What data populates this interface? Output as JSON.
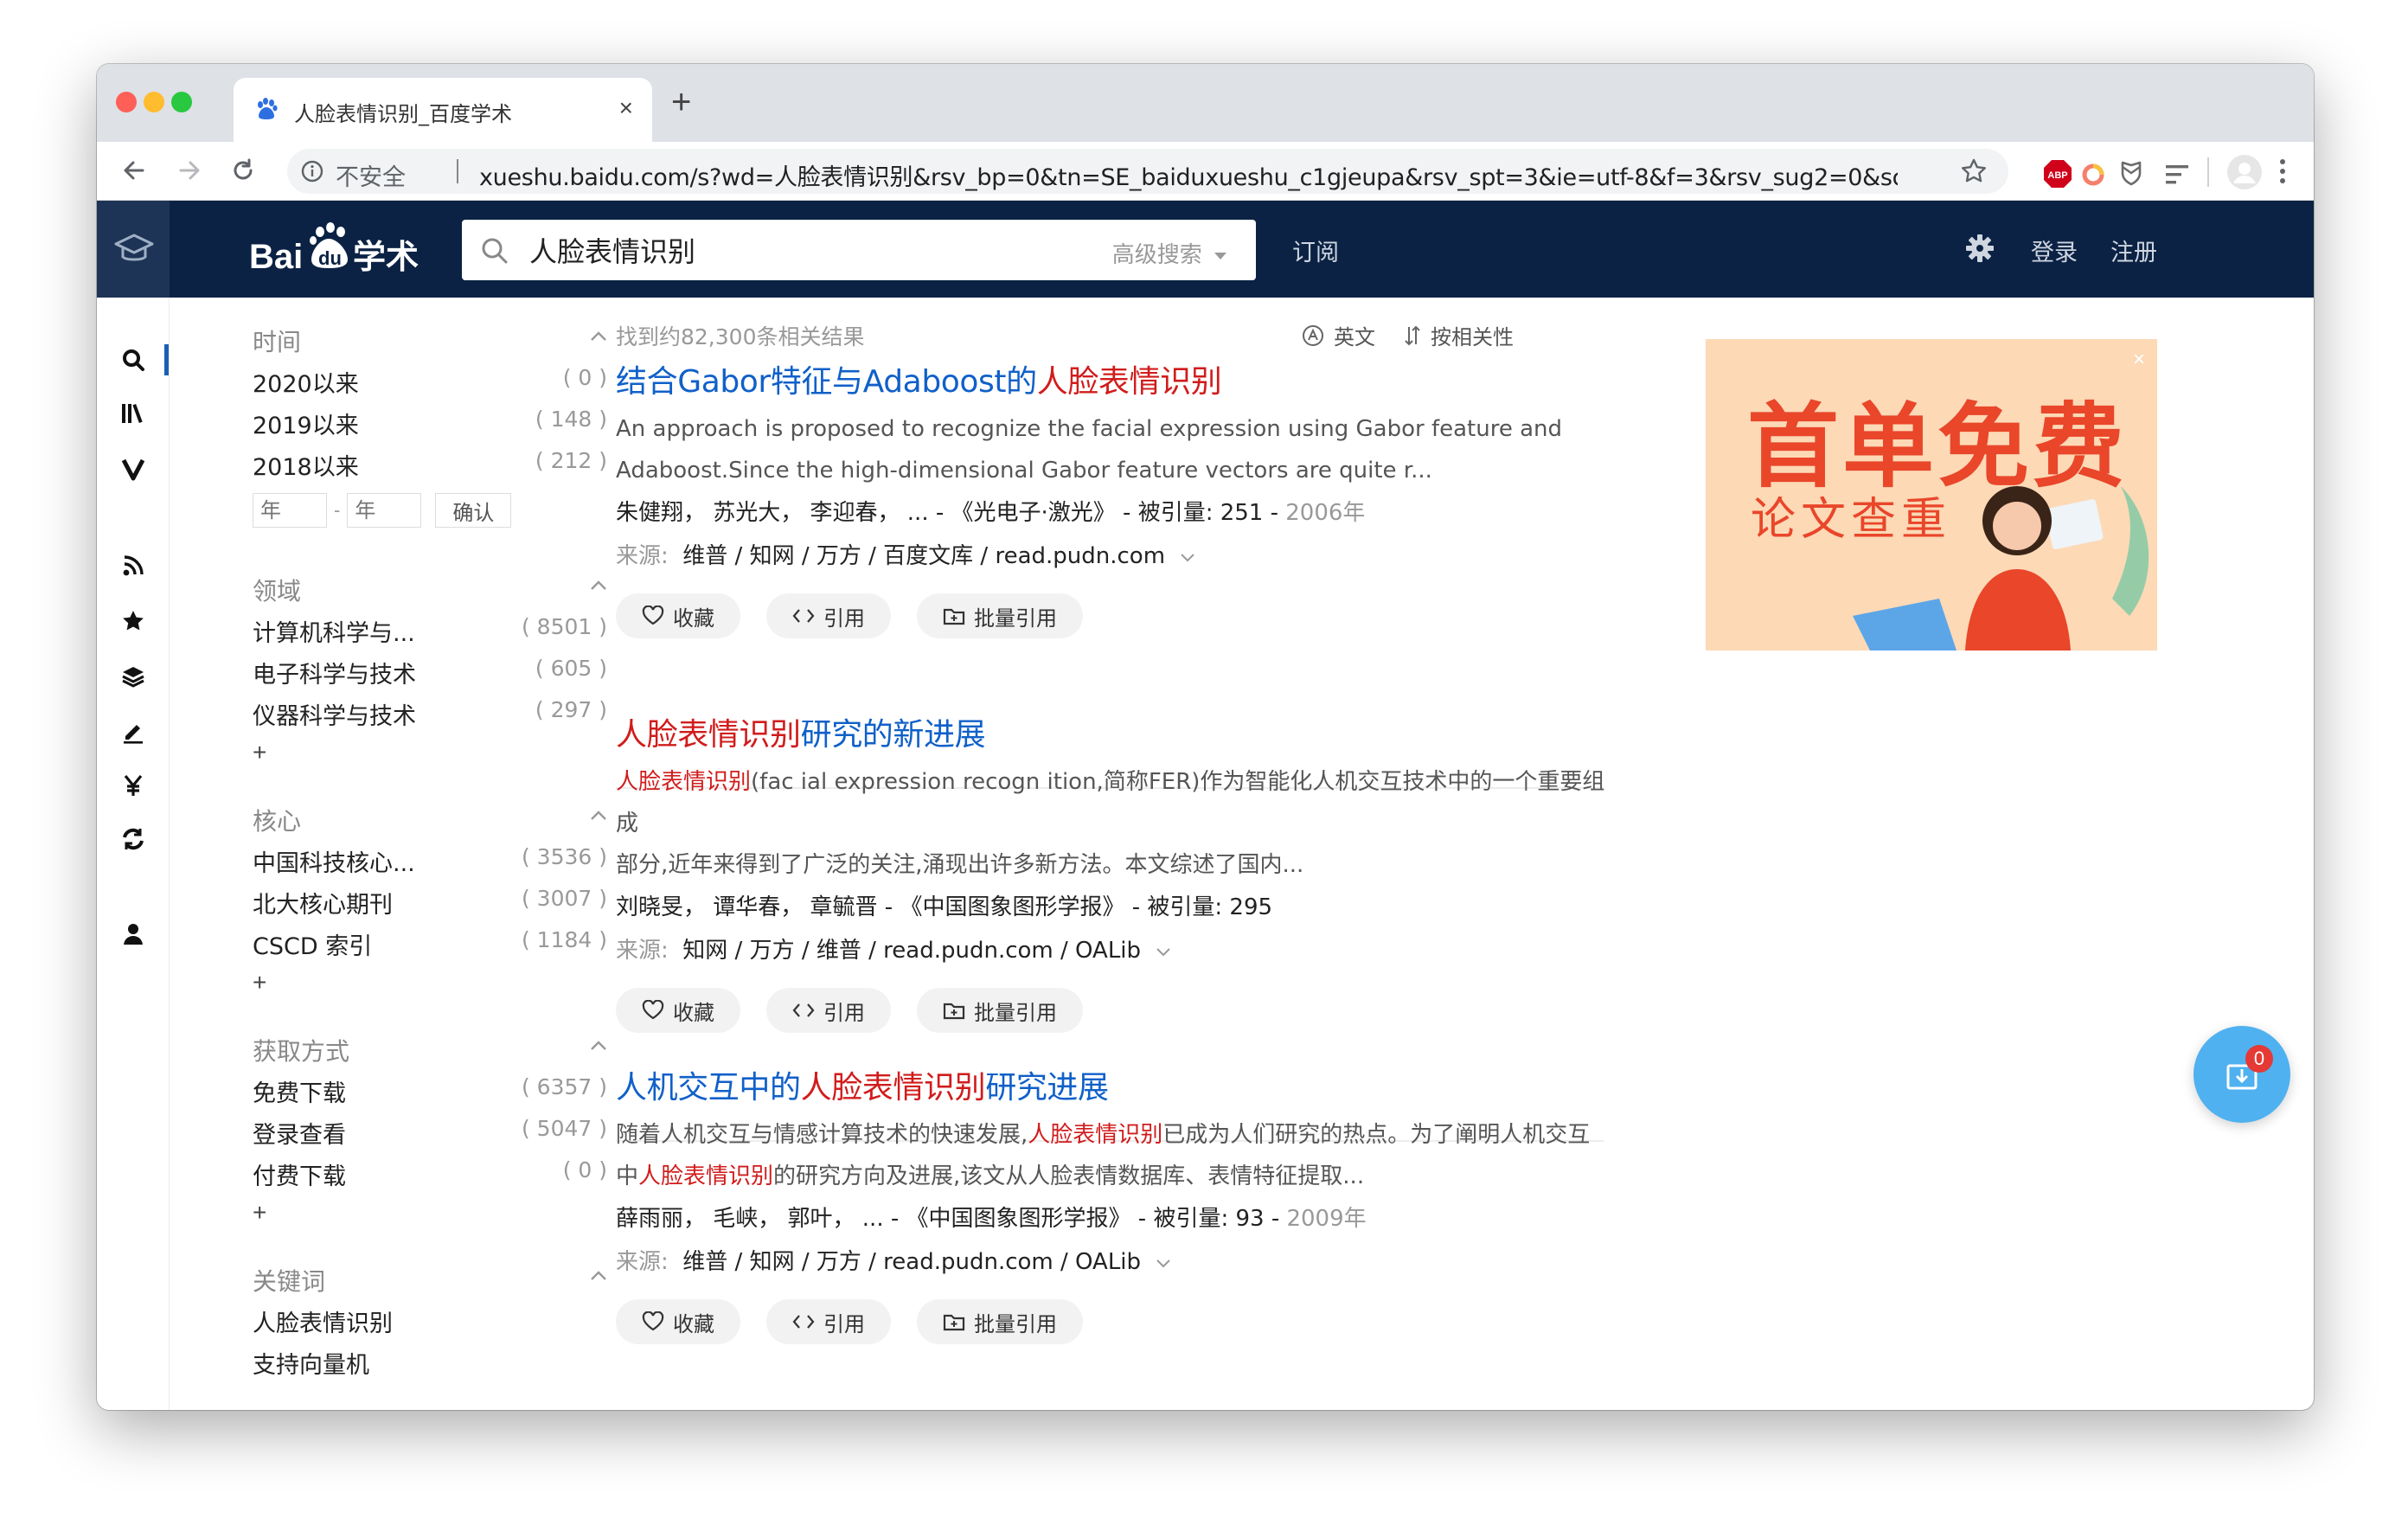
{
  "browser": {
    "tab_title": "人脸表情识别_百度学术",
    "close_glyph": "×",
    "new_tab_glyph": "+",
    "security_label": "不安全",
    "url": "xueshu.baidu.com/s?wd=人脸表情识别&rsv_bp=0&tn=SE_baiduxueshu_c1gjeupa&rsv_spt=3&ie=utf-8&f=3&rsv_sug2=0&sc_f_p...",
    "ext_abp_label": "ABP"
  },
  "header": {
    "logo_text": "Bai",
    "logo_du": "du",
    "logo_suffix": "学术",
    "search_value": "人脸表情识别",
    "advanced_search": "高级搜索",
    "subscribe": "订阅",
    "login": "登录",
    "register": "注册"
  },
  "rail_icons": [
    "search-icon",
    "library-icon",
    "v-icon",
    "rss-icon",
    "star-icon",
    "layers-icon",
    "edit-icon",
    "yen-icon",
    "refresh-icon",
    "user-icon"
  ],
  "filters": {
    "time": {
      "title": "时间",
      "rows": [
        {
          "label": "2020以来",
          "count": "( 0 )"
        },
        {
          "label": "2019以来",
          "count": "( 148 )"
        },
        {
          "label": "2018以来",
          "count": "( 212 )"
        }
      ],
      "year_placeholder": "年",
      "dash": "-",
      "confirm": "确认"
    },
    "field": {
      "title": "领域",
      "rows": [
        {
          "label": "计算机科学与...",
          "count": "( 8501 )"
        },
        {
          "label": "电子科学与技术",
          "count": "( 605 )"
        },
        {
          "label": "仪器科学与技术",
          "count": "( 297 )"
        }
      ],
      "more": "+"
    },
    "core": {
      "title": "核心",
      "rows": [
        {
          "label": "中国科技核心...",
          "count": "( 3536 )"
        },
        {
          "label": "北大核心期刊",
          "count": "( 3007 )"
        },
        {
          "label": "CSCD 索引",
          "count": "( 1184 )"
        }
      ],
      "more": "+"
    },
    "access": {
      "title": "获取方式",
      "rows": [
        {
          "label": "免费下载",
          "count": "( 6357 )"
        },
        {
          "label": "登录查看",
          "count": "( 5047 )"
        },
        {
          "label": "付费下载",
          "count": "( 0 )"
        }
      ],
      "more": "+"
    },
    "keywords": {
      "title": "关键词",
      "rows": [
        {
          "label": "人脸表情识别"
        },
        {
          "label": "支持向量机"
        }
      ]
    }
  },
  "results": {
    "count_text": "找到约82,300条相关结果",
    "lang_label": "英文",
    "sort_label": "按相关性",
    "source_label": "来源:",
    "buttons": {
      "collect": "收藏",
      "cite": "引用",
      "batch_cite": "批量引用"
    },
    "items": [
      {
        "title_pre": "结合Gabor特征与Adaboost的",
        "title_hl": "人脸表情识别",
        "title_post": "",
        "abs_hl": "",
        "abs_1": "An approach is proposed to recognize the facial expression using Gabor feature and",
        "abs_2": "Adaboost.Since the high-dimensional Gabor feature vectors are quite r...",
        "abs_2_hl": "",
        "abs_2_rest": "",
        "authors": "朱健翔， 苏光大， 李迎春， ... -",
        "journal": "《光电子·激光》",
        "cite_text": "- 被引量: 251 -",
        "year": "2006年",
        "sources": "维普  /  知网  /  万方  /  百度文库  /  read.pudn.com"
      },
      {
        "title_pre": "",
        "title_hl": "人脸表情识别",
        "title_post": "研究的新进展",
        "abs_hl": "人脸表情识别",
        "abs_1": "(fac ial expression recogn ition,简称FER)作为智能化人机交互技术中的一个重要组成",
        "abs_2": "部分,近年来得到了广泛的关注,涌现出许多新方法。本文综述了国内...",
        "abs_2_hl": "",
        "abs_2_rest": "",
        "authors": "刘晓旻， 谭华春， 章毓晋 -",
        "journal": "《中国图象图形学报》",
        "cite_text": "- 被引量: 295",
        "year": "",
        "sources": "知网  /  万方  /  维普  /  read.pudn.com  /  OALib"
      },
      {
        "title_pre": "人机交互中的",
        "title_hl": "人脸表情识别",
        "title_post": "研究进展",
        "abs_hl": "",
        "abs_1": "随着人机交互与情感计算技术的快速发展,",
        "abs_1_hl": "人脸表情识别",
        "abs_1_rest": "已成为人们研究的热点。为了阐明人机交互",
        "abs_2": "中",
        "abs_2_hl": "人脸表情识别",
        "abs_2_rest": "的研究方向及进展,该文从人脸表情数据库、表情特征提取...",
        "authors": "薛雨丽， 毛峡， 郭叶， ... -",
        "journal": "《中国图象图形学报》",
        "cite_text": "- 被引量: 93 -",
        "year": "2009年",
        "sources": "维普  /  知网  /  万方  /  read.pudn.com  /  OALib"
      }
    ]
  },
  "ad": {
    "headline": "首单免费",
    "subline": "论文查重",
    "close": "×"
  },
  "fab": {
    "badge": "0"
  },
  "colors": {
    "header_bg": "#0b2244",
    "link": "#1060c9",
    "highlight": "#d11c1c",
    "fab": "#4fb1ef"
  }
}
